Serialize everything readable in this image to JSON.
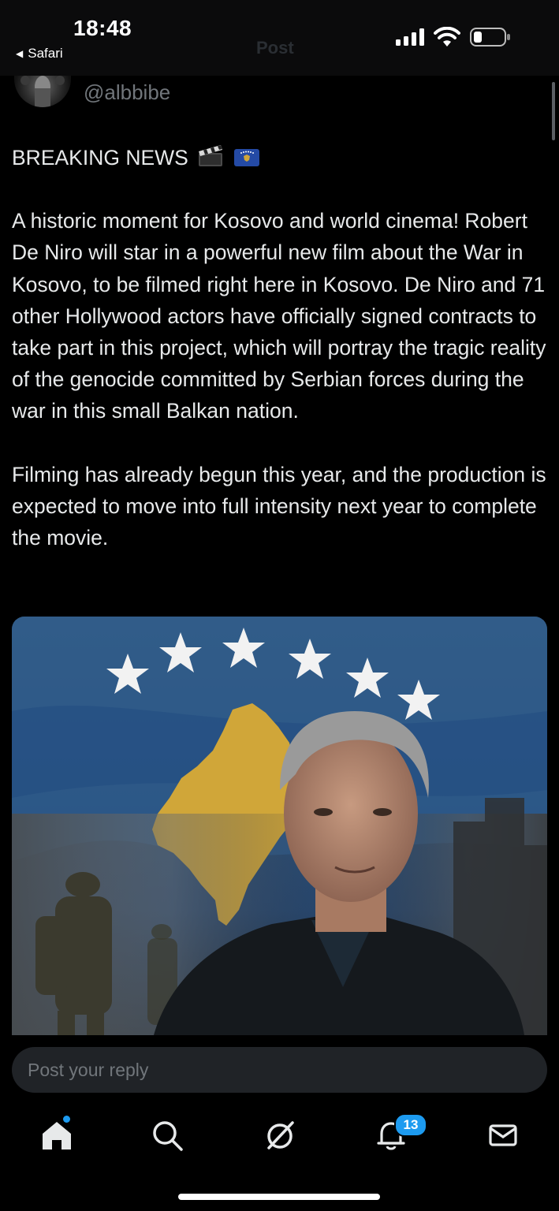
{
  "status_bar": {
    "time": "18:48",
    "back_label": "Safari",
    "header_title": "Post"
  },
  "post": {
    "handle": "@albbibe",
    "paragraphs": [
      "BREAKING NEWS",
      "A historic moment for Kosovo and world cinema! Robert De Niro will star in a powerful new film about the War in Kosovo, to be filmed right here in Kosovo. De Niro and 71 other Hollywood actors have officially signed contracts to take part in this project, which will portray the tragic reality of the genocide committed by Serbian forces during the war in this small Balkan nation.",
      "Filming has already begun this year, and the production is expected to move into full intensity next year to complete the movie."
    ],
    "emojis": [
      "clapper-board-icon",
      "kosovo-flag-icon"
    ]
  },
  "reply": {
    "placeholder": "Post your reply"
  },
  "tabbar": {
    "items": [
      "home-icon",
      "search-icon",
      "grok-icon",
      "notifications-icon",
      "messages-icon"
    ],
    "notifications_badge": "13"
  },
  "colors": {
    "background": "#000000",
    "text": "#e7e9ea",
    "muted": "#71767b",
    "accent": "#1d9bf0",
    "flag_blue": "#244aa5",
    "flag_gold": "#d0a639"
  }
}
